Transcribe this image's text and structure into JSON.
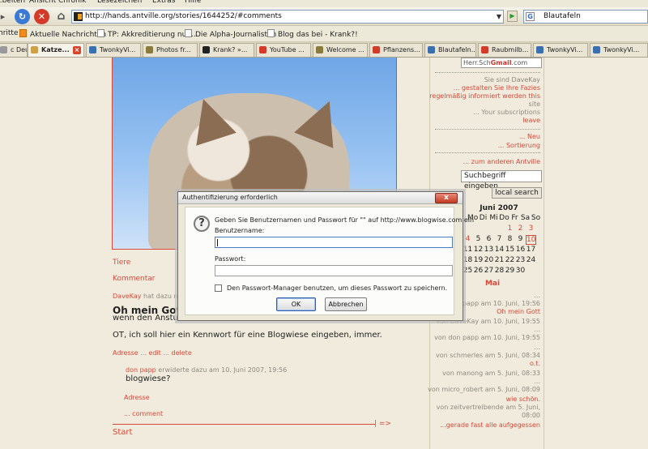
{
  "browser": {
    "menu": [
      "...beiten",
      "Ansicht",
      "Chronik",
      "Lesezeichen",
      "Extras",
      "Hilfe"
    ],
    "url": "http://hands.antville.org/stories/1644252/#comments",
    "search_value": "Blautafeln",
    "bookmarks": [
      {
        "label": "hritte",
        "icon": "none"
      },
      {
        "label": "Aktuelle Nachrichten",
        "icon": "rss-icon"
      },
      {
        "label": "TP: Akkreditierung nur...",
        "icon": "page-icon"
      },
      {
        "label": "Die Alpha-Journalisten",
        "icon": "page-icon"
      },
      {
        "label": "Blog das bei - Krank?!",
        "icon": "page-icon"
      }
    ],
    "tabs": [
      {
        "label": "c Deu...",
        "color": "#999999"
      },
      {
        "label": "Katze...",
        "color": "#cfa04a",
        "active": true
      },
      {
        "label": "TwonkyVi...",
        "color": "#3a6fb0"
      },
      {
        "label": "Photos fr...",
        "color": "#8a7a3c"
      },
      {
        "label": "Krank? »...",
        "color": "#222222"
      },
      {
        "label": "YouTube ...",
        "color": "#d23a2a"
      },
      {
        "label": "Welcome ...",
        "color": "#8a7a3c"
      },
      {
        "label": "Pflanzens...",
        "color": "#d23a2a"
      },
      {
        "label": "Blautafeln...",
        "color": "#3a6fb0"
      },
      {
        "label": "Raubmilb...",
        "color": "#d23a2a"
      },
      {
        "label": "TwonkyVi...",
        "color": "#3a6fb0"
      },
      {
        "label": "TwonkyVi...",
        "color": "#3a6fb0"
      }
    ]
  },
  "post": {
    "category": "Tiere",
    "comment_link": "Kommentar",
    "author": "DaveKay",
    "author_meta": "hat dazu n",
    "title": "Oh mein Gott",
    "line1": "wenn den Anstur",
    "line2": "OT, ich soll hier ein Kennwort für eine Blogwiese eingeben, immer.",
    "links": [
      "Adresse",
      "edit",
      "delete"
    ],
    "reply_author": "don papp",
    "reply_meta": "erwiderte dazu am 10. Juni 2007, 19:56",
    "reply_text": "blogwiese?",
    "reply_link": "Adresse",
    "comment_action": "... comment",
    "reply_arrow": "| =>",
    "start": "Start"
  },
  "sidebar": {
    "gmail_prefix": "Herr.Sch",
    "gmail_brand": "Gmail",
    "gmail_suffix": ".com",
    "info": [
      {
        "text": "Sie sind DaveKay",
        "red": false
      },
      {
        "text": "... gestalten Sie Ihre Fazies",
        "red": true
      },
      {
        "text": "regelmäßig informiert werden this",
        "red": true
      },
      {
        "text": "site",
        "red": false
      },
      {
        "text": "... Your subscriptions",
        "red": false
      },
      {
        "text": "leave",
        "red": true
      }
    ],
    "links": [
      "... Neu",
      "... Sortierung",
      "... zum anderen Antville"
    ],
    "search_value": "Suchbegriff eingeben",
    "search_button": "local search",
    "calendar_title": "Juni 2007",
    "weekdays": [
      "Mo",
      "Di",
      "Mi",
      "Do",
      "Fr",
      "Sa",
      "So"
    ],
    "calendar_rows": [
      [
        "",
        "",
        "",
        "",
        "1",
        "2",
        "3"
      ],
      [
        "4",
        "5",
        "6",
        "7",
        "8",
        "9",
        "10"
      ],
      [
        "11",
        "12",
        "13",
        "14",
        "15",
        "16",
        "17"
      ],
      [
        "18",
        "19",
        "20",
        "21",
        "22",
        "23",
        "24"
      ],
      [
        "25",
        "26",
        "27",
        "28",
        "29",
        "30",
        ""
      ]
    ],
    "calendar_link": "Mai",
    "recent": [
      {
        "text": "...",
        "red": false
      },
      {
        "text": "papp am 10. Juni, 19:56",
        "red": false
      },
      {
        "text": "Oh mein Gott",
        "red": true
      },
      {
        "text": "von DaveKay am 10. Juni, 19:55",
        "red": false
      },
      {
        "text": "...",
        "red": false
      },
      {
        "text": "von don papp am 10. Juni, 19:55",
        "red": false
      },
      {
        "text": "...",
        "red": false
      },
      {
        "text": "von schmerles am 5. Juni, 08:34",
        "red": false
      },
      {
        "text": "o.t.",
        "red": true
      },
      {
        "text": "von manong am 5. Juni, 08:33",
        "red": false
      },
      {
        "text": "...",
        "red": false
      },
      {
        "text": "von micro_robert am 5. Juni, 08:09",
        "red": false
      },
      {
        "text": "wie schön.",
        "red": true
      },
      {
        "text": "von zeitvertreibende am 5. Juni,",
        "red": false
      },
      {
        "text": "08:00",
        "red": false
      },
      {
        "text": "...gerade fast alle aufgegessen",
        "red": true
      }
    ]
  },
  "dialog": {
    "title": "Authentifizierung erforderlich",
    "close": "x",
    "message": "Geben Sie Benutzernamen und Passwort für \"\" auf http://www.blogwise.com ein",
    "username_label": "Benutzername:",
    "username_value": "",
    "password_label": "Passwort:",
    "password_value": "",
    "remember_label": "Den Passwort-Manager benutzen, um dieses Passwort zu speichern.",
    "remember_checked": false,
    "ok": "OK",
    "cancel": "Abbrechen"
  }
}
